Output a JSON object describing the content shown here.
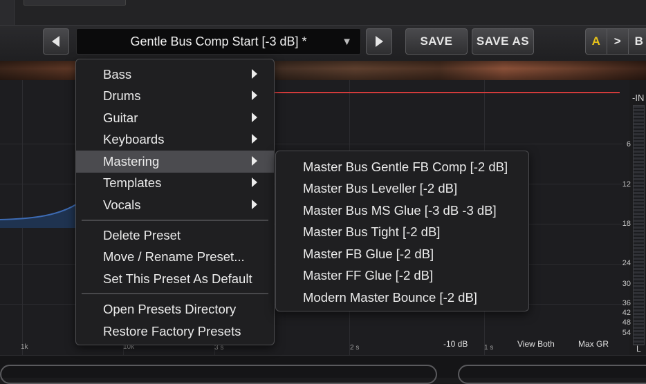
{
  "toolbar": {
    "preset_name": "Gentle Bus Comp Start [-3 dB] *",
    "prev_icon": "triangle-left-icon",
    "next_icon": "triangle-right-icon",
    "dropdown_icon": "triangle-down-icon",
    "save_label": "SAVE",
    "save_as_label": "SAVE AS",
    "ab_a": "A",
    "ab_copy": ">",
    "ab_b": "B"
  },
  "colors": {
    "accent_a": "#e7c21a",
    "threshold_line": "#d23b3b",
    "menu_highlight": "#4b4b4f"
  },
  "menu": {
    "categories": [
      {
        "label": "Bass"
      },
      {
        "label": "Drums"
      },
      {
        "label": "Guitar"
      },
      {
        "label": "Keyboards"
      },
      {
        "label": "Mastering"
      },
      {
        "label": "Templates"
      },
      {
        "label": "Vocals"
      }
    ],
    "actions": [
      {
        "label": "Delete Preset"
      },
      {
        "label": "Move / Rename Preset..."
      },
      {
        "label": "Set This Preset As Default"
      }
    ],
    "directory_actions": [
      {
        "label": "Open Presets Directory"
      },
      {
        "label": "Restore Factory Presets"
      }
    ],
    "highlighted": "Mastering"
  },
  "submenu": {
    "items": [
      {
        "label": "Master Bus Gentle FB Comp [-2 dB]"
      },
      {
        "label": "Master Bus Leveller [-2 dB]"
      },
      {
        "label": "Master Bus MS Glue [-3 dB -3 dB]"
      },
      {
        "label": "Master Bus Tight [-2 dB]"
      },
      {
        "label": "Master FB Glue [-2 dB]"
      },
      {
        "label": "Master FF Glue [-2 dB]"
      },
      {
        "label": "Modern Master Bounce [-2 dB]"
      }
    ]
  },
  "meter": {
    "top_label": "-IN",
    "bottom_label": "L",
    "scale": [
      "6",
      "12",
      "18",
      "24",
      "30",
      "36",
      "42",
      "48",
      "54"
    ]
  },
  "graph": {
    "freq_labels": [
      "1k",
      "10k"
    ],
    "time_labels": [
      "3 s",
      "2 s",
      "1 s"
    ],
    "db_label": "-10 dB",
    "view_label": "View Both",
    "max_gr_label": "Max GR"
  }
}
